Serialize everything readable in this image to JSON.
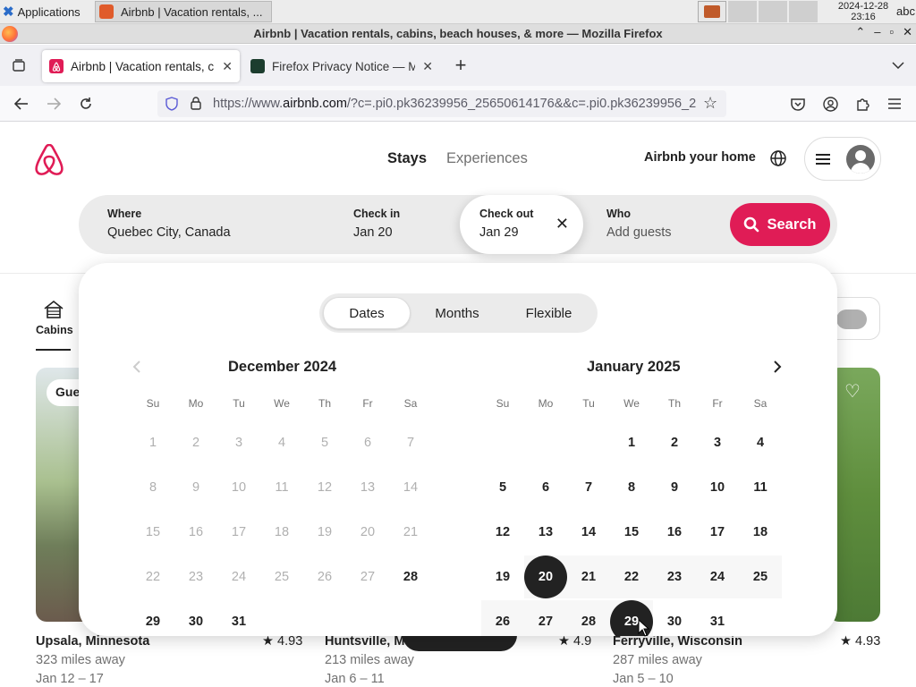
{
  "os": {
    "applications_label": "Applications",
    "task_label": "Airbnb | Vacation rentals, ...",
    "clock_date": "2024-12-28",
    "clock_time": "23:16",
    "keyboard": "abc"
  },
  "window": {
    "title": "Airbnb | Vacation rentals, cabins, beach houses, & more — Mozilla Firefox"
  },
  "tabs": [
    {
      "label": "Airbnb | Vacation rentals, c"
    },
    {
      "label": "Firefox Privacy Notice — M"
    }
  ],
  "url": {
    "prefix": "https://www.",
    "domain": "airbnb.com",
    "rest": "/?c=.pi0.pk36239956_25650614176&&c=.pi0.pk36239956_2"
  },
  "header": {
    "stays": "Stays",
    "experiences": "Experiences",
    "host_link": "Airbnb your home"
  },
  "search": {
    "where_label": "Where",
    "where_value": "Quebec City, Canada",
    "checkin_label": "Check in",
    "checkin_value": "Jan 20",
    "checkout_label": "Check out",
    "checkout_value": "Jan 29",
    "who_label": "Who",
    "who_value": "Add guests",
    "search_button": "Search"
  },
  "calendar": {
    "modes": [
      "Dates",
      "Months",
      "Flexible"
    ],
    "selected_mode": "Dates",
    "weekdays": [
      "Su",
      "Mo",
      "Tu",
      "We",
      "Th",
      "Fr",
      "Sa"
    ],
    "left_month": {
      "title": "December 2024",
      "first_weekday": 0,
      "days": 31,
      "available_from": 28
    },
    "right_month": {
      "title": "January 2025",
      "first_weekday": 3,
      "days": 31,
      "range_start": 20,
      "range_end": 29
    }
  },
  "categories": {
    "cabins": "Cabins"
  },
  "listings": [
    {
      "name": "Upsala, Minnesota",
      "distance": "323 miles away",
      "dates": "Jan 12 – 17",
      "rating": "4.93",
      "badge": "Gue"
    },
    {
      "name": "Huntsville, M",
      "distance": "213 miles away",
      "dates": "Jan 6 – 11",
      "rating": "4.9"
    },
    {
      "name": "Ferryville, Wisconsin",
      "distance": "287 miles away",
      "dates": "Jan 5 – 10",
      "rating": "4.93"
    }
  ],
  "colors": {
    "brand": "#e01c56",
    "selected_day": "#222222"
  }
}
